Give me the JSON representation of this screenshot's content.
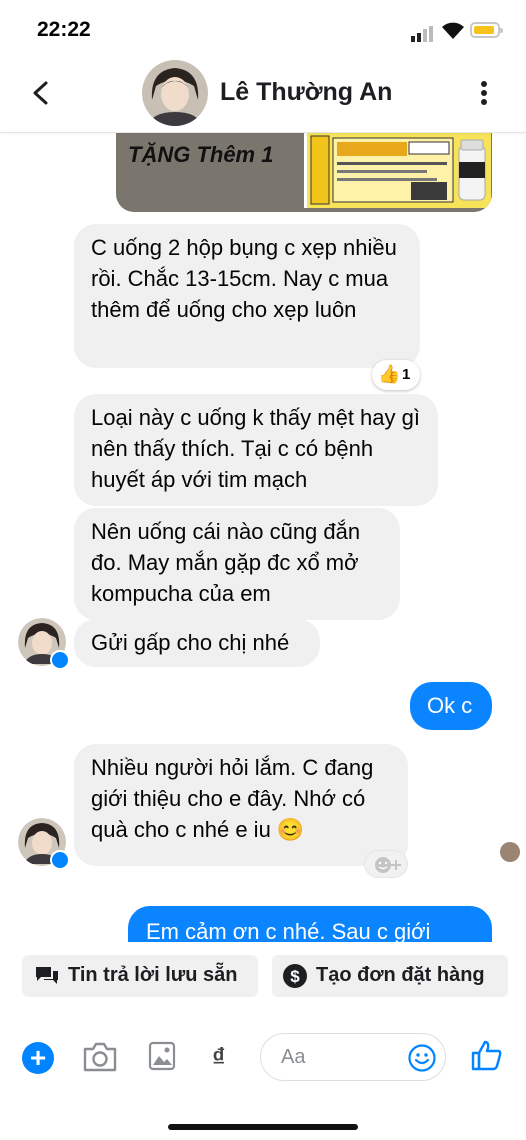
{
  "status_bar": {
    "time": "22:22"
  },
  "header": {
    "contact_name": "Lê Thường An"
  },
  "promo_image": {
    "caption": "TẶNG Thêm 1"
  },
  "messages": [
    {
      "direction": "incoming",
      "text": "C uống 2 hộp bụng c xẹp nhiều rồi. Chắc 13-15cm. Nay c mua thêm để uống cho xẹp luôn",
      "reaction": {
        "emoji": "👍",
        "count": "1"
      }
    },
    {
      "direction": "incoming",
      "text": "Loại này c uống k thấy mệt hay gì nên thấy thích. Tại c có bệnh huyết áp với tim mạch"
    },
    {
      "direction": "incoming",
      "text": "Nên uống cái nào cũng đắn đo. May mắn gặp đc xổ mở kompucha của em"
    },
    {
      "direction": "incoming",
      "text": "Gửi gấp cho chị nhé"
    },
    {
      "direction": "outgoing",
      "text": "Ok c"
    },
    {
      "direction": "incoming",
      "text": "Nhiều người hỏi lắm. C đang giới thiệu cho e đây. Nhớ có quà cho c nhé e iu 😊"
    },
    {
      "direction": "outgoing",
      "text": "Em cảm ơn c nhé. Sau c giới"
    }
  ],
  "quick_replies": [
    {
      "label": "Tin trả lời lưu sẵn",
      "icon": "saved-replies-icon"
    },
    {
      "label": "Tạo đơn đặt hàng",
      "icon": "dollar-icon"
    }
  ],
  "composer": {
    "placeholder": "Aa",
    "currency_symbol": "₫"
  },
  "colors": {
    "accent": "#0084ff",
    "outgoing_bubble": "#0b84ff",
    "incoming_bubble": "#f0f0f0"
  }
}
